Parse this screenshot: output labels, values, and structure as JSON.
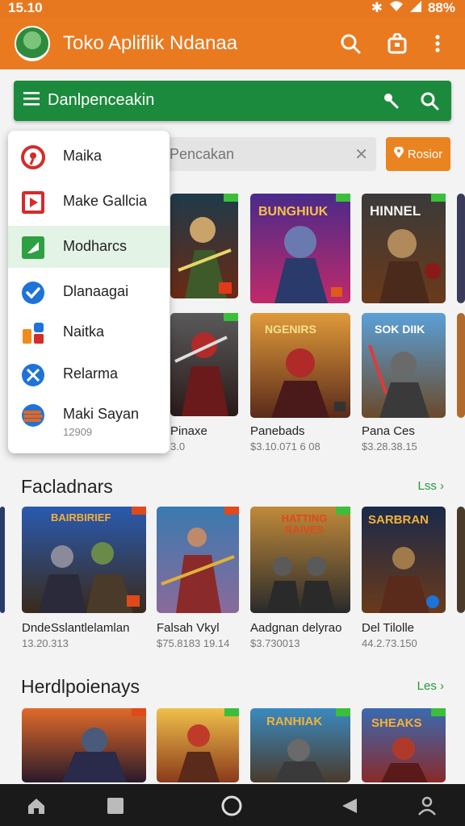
{
  "status_bar": {
    "time": "15.10",
    "battery": "88%"
  },
  "app_bar": {
    "title": "Toko Apliflik Ndanaa"
  },
  "green_bar": {
    "title": "Danlpenceakin"
  },
  "search": {
    "placeholder": "Pencakan",
    "button_label": "Rosior"
  },
  "drawer": {
    "items": [
      {
        "label": "Maika",
        "icon": "circle-target-icon",
        "color": "#d42b2b"
      },
      {
        "label": "Make Gallcia",
        "icon": "play-box-icon",
        "color": "#d42b2b"
      },
      {
        "label": "Modharcs",
        "icon": "leaf-box-icon",
        "color": "#2ea043",
        "active": true
      },
      {
        "label": "Dlanaagai",
        "icon": "check-circle-icon",
        "color": "#1e73d8"
      },
      {
        "label": "Naitka",
        "icon": "blocks-icon",
        "color": "#f08a1d"
      },
      {
        "label": "Relarma",
        "icon": "tools-circle-icon",
        "color": "#1e73d8"
      },
      {
        "label": "Maki Sayan",
        "sub": "12909",
        "icon": "stack-circle-icon",
        "color": "#e8661d"
      }
    ]
  },
  "top_grid": {
    "row1": [
      {
        "art_title": ""
      },
      {
        "art_title": "BUNGHIUK"
      },
      {
        "art_title": "HINNEL"
      }
    ],
    "row2": [
      {
        "name": "Pinaxe",
        "meta": "3.0",
        "art_title": ""
      },
      {
        "name": "Panebads",
        "meta": "$3.10.071 6 08",
        "art_title": "NGENIRS"
      },
      {
        "name": "Pana Ces",
        "meta": "$3.28.38.15",
        "art_title": "SOK DIIK"
      }
    ]
  },
  "section1": {
    "title": "Facladnars",
    "see_more": "Lss",
    "games": [
      {
        "name": "DndeSslantlelamlan",
        "meta": "13.20.313",
        "art_title": "BAIRBIRIEF"
      },
      {
        "name": "Falsah Vkyl",
        "meta": "$75.8183 19.14",
        "art_title": ""
      },
      {
        "name": "Aadgnan delyrao",
        "meta": "$3.730013",
        "art_title": "HATTING RAIVES"
      },
      {
        "name": "Del Tilolle",
        "meta": "44.2.73.150",
        "art_title": "SARBRAN"
      }
    ]
  },
  "section2": {
    "title": "Herdlpoienays",
    "see_more": "Les",
    "games": [
      {
        "art_title": ""
      },
      {
        "art_title": ""
      },
      {
        "art_title": "RANHIAK"
      },
      {
        "art_title": "SHEAKS"
      }
    ]
  },
  "colors": {
    "accent": "#ea7a20",
    "green": "#1c8a3c",
    "link": "#1f9a3b"
  }
}
